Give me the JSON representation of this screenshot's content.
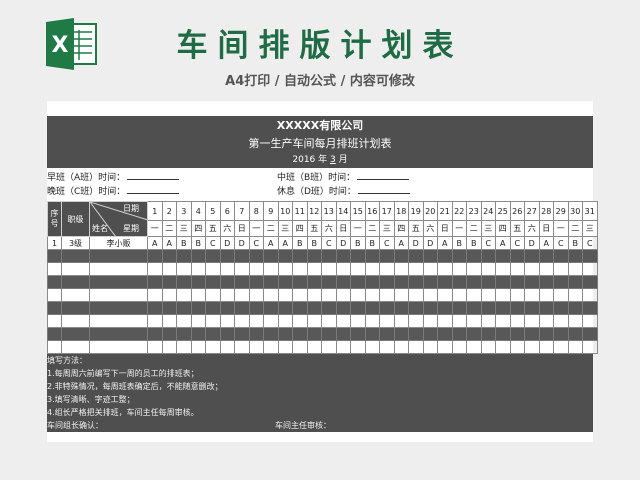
{
  "banner": {
    "title": "车间排版计划表",
    "subtitle": "A4打印 / 自动公式 / 内容可修改",
    "logo_letter": "X",
    "logo_color": "#1f7a45"
  },
  "sheet": {
    "company": "XXXXX有限公司",
    "title": "第一生产车间每月排班计划表",
    "date_prefix": "2016 年 ",
    "month": "3",
    "date_suffix": " 月"
  },
  "shifts": {
    "morning": "早班（A班）时间：",
    "middle": "中班（B班）时间：",
    "evening": "晚班（C班）时间：",
    "rest": "休息（D班）时间："
  },
  "table": {
    "col_seq": "序号",
    "col_level": "职级",
    "diag_date": "日期",
    "diag_name": "姓名",
    "diag_week": "星期",
    "days": [
      "1",
      "2",
      "3",
      "4",
      "5",
      "6",
      "7",
      "8",
      "9",
      "10",
      "11",
      "12",
      "13",
      "14",
      "15",
      "16",
      "17",
      "18",
      "19",
      "20",
      "21",
      "22",
      "23",
      "24",
      "25",
      "26",
      "27",
      "28",
      "29",
      "30",
      "31"
    ],
    "weekdays": [
      "一",
      "二",
      "三",
      "四",
      "五",
      "六",
      "日",
      "一",
      "二",
      "三",
      "四",
      "五",
      "六",
      "日",
      "一",
      "二",
      "三",
      "四",
      "五",
      "六",
      "日",
      "一",
      "二",
      "三",
      "四",
      "五",
      "六",
      "日",
      "一",
      "二",
      "三"
    ],
    "rows": [
      {
        "seq": "1",
        "level": "3级",
        "name": "李小贩",
        "shifts": [
          "A",
          "A",
          "B",
          "B",
          "C",
          "D",
          "D",
          "C",
          "A",
          "A",
          "B",
          "B",
          "C",
          "D",
          "B",
          "B",
          "C",
          "A",
          "D",
          "D",
          "A",
          "B",
          "B",
          "C",
          "A",
          "C",
          "D",
          "A",
          "C",
          "B",
          "C"
        ]
      }
    ],
    "empty_row_count": 8
  },
  "notes": {
    "heading": "填写方法：",
    "items": [
      "1.每周周六前编写下一周的员工的排班表；",
      "2.非特殊情况，每周班表确定后，不能随意删改；",
      "3.填写清晰、字迹工整；",
      "4.组长严格把关排班，车间主任每周审核。"
    ],
    "sign_leader": "车间组长确认：",
    "sign_director": "车间主任审核："
  }
}
